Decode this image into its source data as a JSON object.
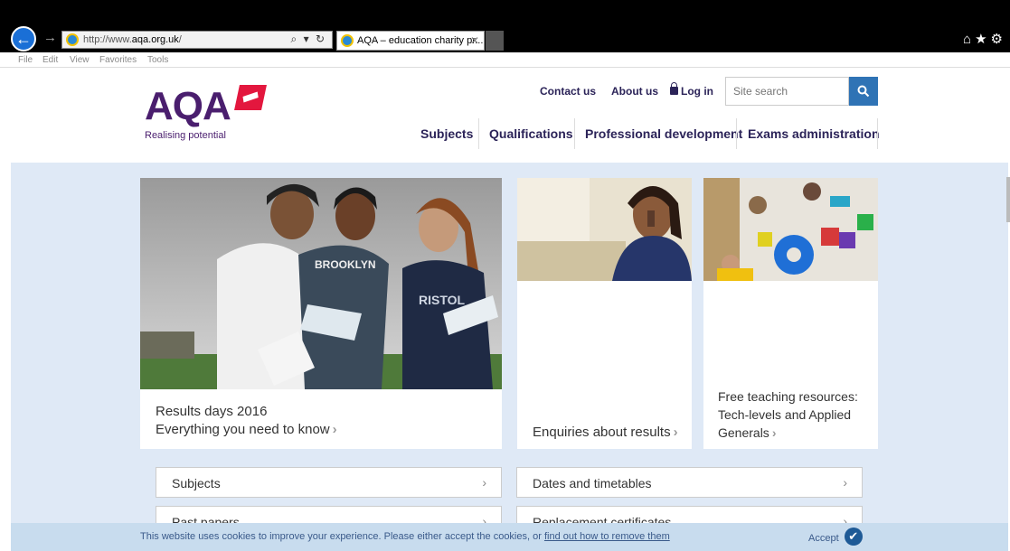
{
  "browser": {
    "url_prefix": "http://www.",
    "url_domain": "aqa.org.uk",
    "url_suffix": "/",
    "address_tools": "⌕ ▾ ↻",
    "tab_title": "AQA – education charity pr...",
    "tab_close": "✕",
    "menu": [
      "File",
      "Edit",
      "View",
      "Favorites",
      "Tools"
    ]
  },
  "header": {
    "logo": "AQA",
    "tagline": "Realising potential",
    "utility_links": [
      "Contact us",
      "About us",
      "Log in"
    ],
    "search_placeholder": "Site search",
    "nav": [
      "Subjects",
      "Qualifications",
      "Professional development",
      "Exams administration"
    ]
  },
  "cards": {
    "results_days_line1": "Results days 2016",
    "results_days_line2": "Everything you need to know",
    "enquiries": "Enquiries about results",
    "teaching_line1": "Free teaching resources:",
    "teaching_line2": "Tech-levels and Applied",
    "teaching_line3": "Generals"
  },
  "quick_links": {
    "left": [
      "Subjects",
      "Past papers"
    ],
    "right": [
      "Dates and timetables",
      "Replacement certificates"
    ],
    "arrow": "›"
  },
  "cookie": {
    "message": "This website uses cookies to improve your experience. Please either accept the cookies, or ",
    "link": "find out how to remove them",
    "accept": "Accept"
  },
  "colors": {
    "brand_purple": "#4a1e6e",
    "brand_red": "#e3173e",
    "search_blue": "#2f73b5",
    "page_bg": "#dfe9f6"
  },
  "icons": [
    "back-arrow-icon",
    "forward-arrow-icon",
    "ie-icon",
    "search-icon",
    "lock-icon",
    "home-icon",
    "star-icon",
    "gear-icon",
    "checkmark-icon"
  ]
}
